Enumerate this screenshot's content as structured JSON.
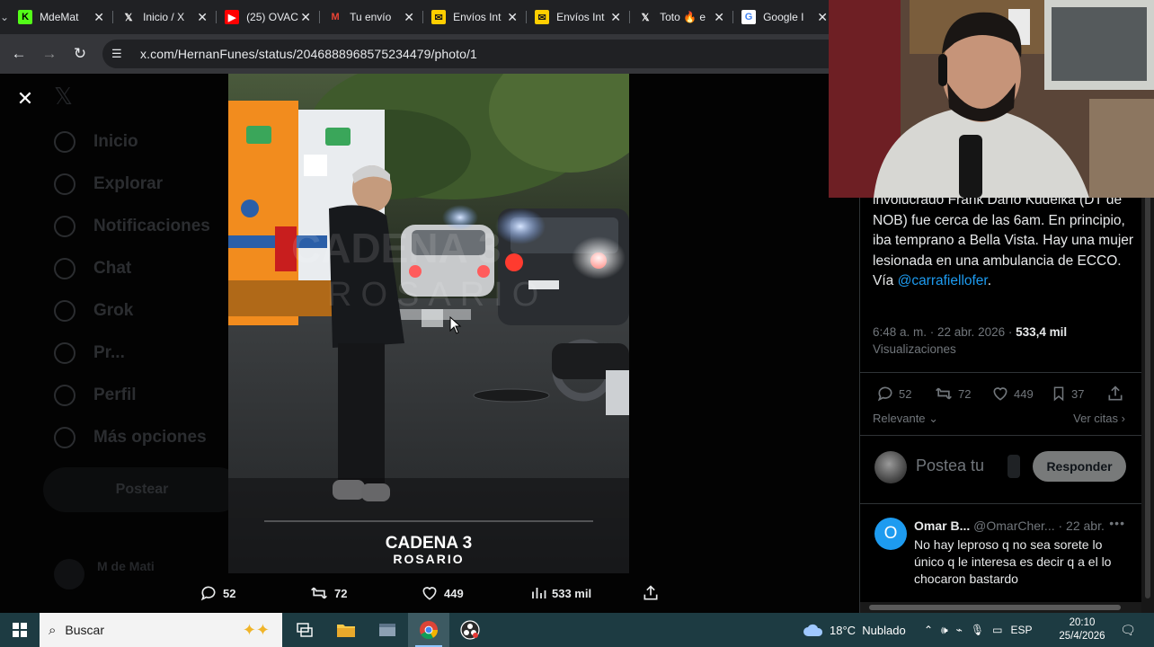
{
  "browser": {
    "tabs": [
      {
        "title": "MdeMat",
        "favicon": "kick-icon",
        "favicon_text": "K",
        "color": "#53fc18",
        "fg": "#000"
      },
      {
        "title": "Inicio / X",
        "favicon": "x-icon",
        "favicon_text": "𝕏",
        "color": "transparent",
        "fg": "#fff"
      },
      {
        "title": "(25) OVAC",
        "favicon": "youtube-icon",
        "favicon_text": "▶",
        "color": "#ff0000",
        "fg": "#fff"
      },
      {
        "title": "Tu envío",
        "favicon": "gmail-icon",
        "favicon_text": "M",
        "color": "transparent",
        "fg": "#ea4335"
      },
      {
        "title": "Envíos Int",
        "favicon": "correo-icon",
        "favicon_text": "✉",
        "color": "#ffce00",
        "fg": "#1a1a1a"
      },
      {
        "title": "Envíos Int",
        "favicon": "correo-icon",
        "favicon_text": "✉",
        "color": "#ffce00",
        "fg": "#1a1a1a"
      },
      {
        "title": "Toto 🔥 e",
        "favicon": "x-icon",
        "favicon_text": "𝕏",
        "color": "transparent",
        "fg": "#fff"
      },
      {
        "title": "Google I",
        "favicon": "google-icon",
        "favicon_text": "G",
        "color": "#fff",
        "fg": "#4285f4"
      }
    ],
    "url": "x.com/HernanFunes/status/2046888968575234479/photo/1"
  },
  "x_sidebar": {
    "items": [
      "Inicio",
      "Explorar",
      "Notificaciones",
      "Chat",
      "Grok",
      "Pr...",
      "Perfil",
      "Más opciones"
    ],
    "post_button": "Postear",
    "account_name": "M de Mati"
  },
  "photo": {
    "watermark": "CADENA 3",
    "watermark_sub": "ROSARIO",
    "bg_watermark_1": "CADENA 3",
    "bg_watermark_2": "ROSARIO",
    "stats": {
      "replies": "52",
      "reposts": "72",
      "likes": "449",
      "views": "533 mil"
    }
  },
  "tweet": {
    "text_line1": "involucrado Frank Darío Kudelka (DT de NOB) fue cerca de las 6am. En principio, iba temprano a Bella Vista. Hay una mujer lesionada en una ambulancia de ECCO. Vía ",
    "mention": "@carrafiellofer",
    "text_end": ".",
    "time": "6:48 a. m. · 22 abr. 2026 · ",
    "views_count": "533,4 mil",
    "views_label": "Visualizaciones",
    "stats": {
      "replies": "52",
      "reposts": "72",
      "likes": "449",
      "bookmarks": "37"
    },
    "sort": "Relevante",
    "quotes": "Ver citas",
    "reply_placeholder": "Postea tu",
    "reply_button": "Responder"
  },
  "comment": {
    "avatar_letter": "O",
    "name": "Omar B...",
    "handle": "@OmarCher...",
    "date": "· 22 abr.",
    "text": "No hay leproso q no sea sorete lo único q le interesa es decir q a el lo chocaron bastardo"
  },
  "taskbar": {
    "search_placeholder": "Buscar",
    "weather": "18°C  Nublado",
    "lang": "ESP",
    "time": "20:10",
    "date": "25/4/2026"
  },
  "colors": {
    "x_blue": "#1d9bf0",
    "taskbar": "#1d3b42"
  }
}
